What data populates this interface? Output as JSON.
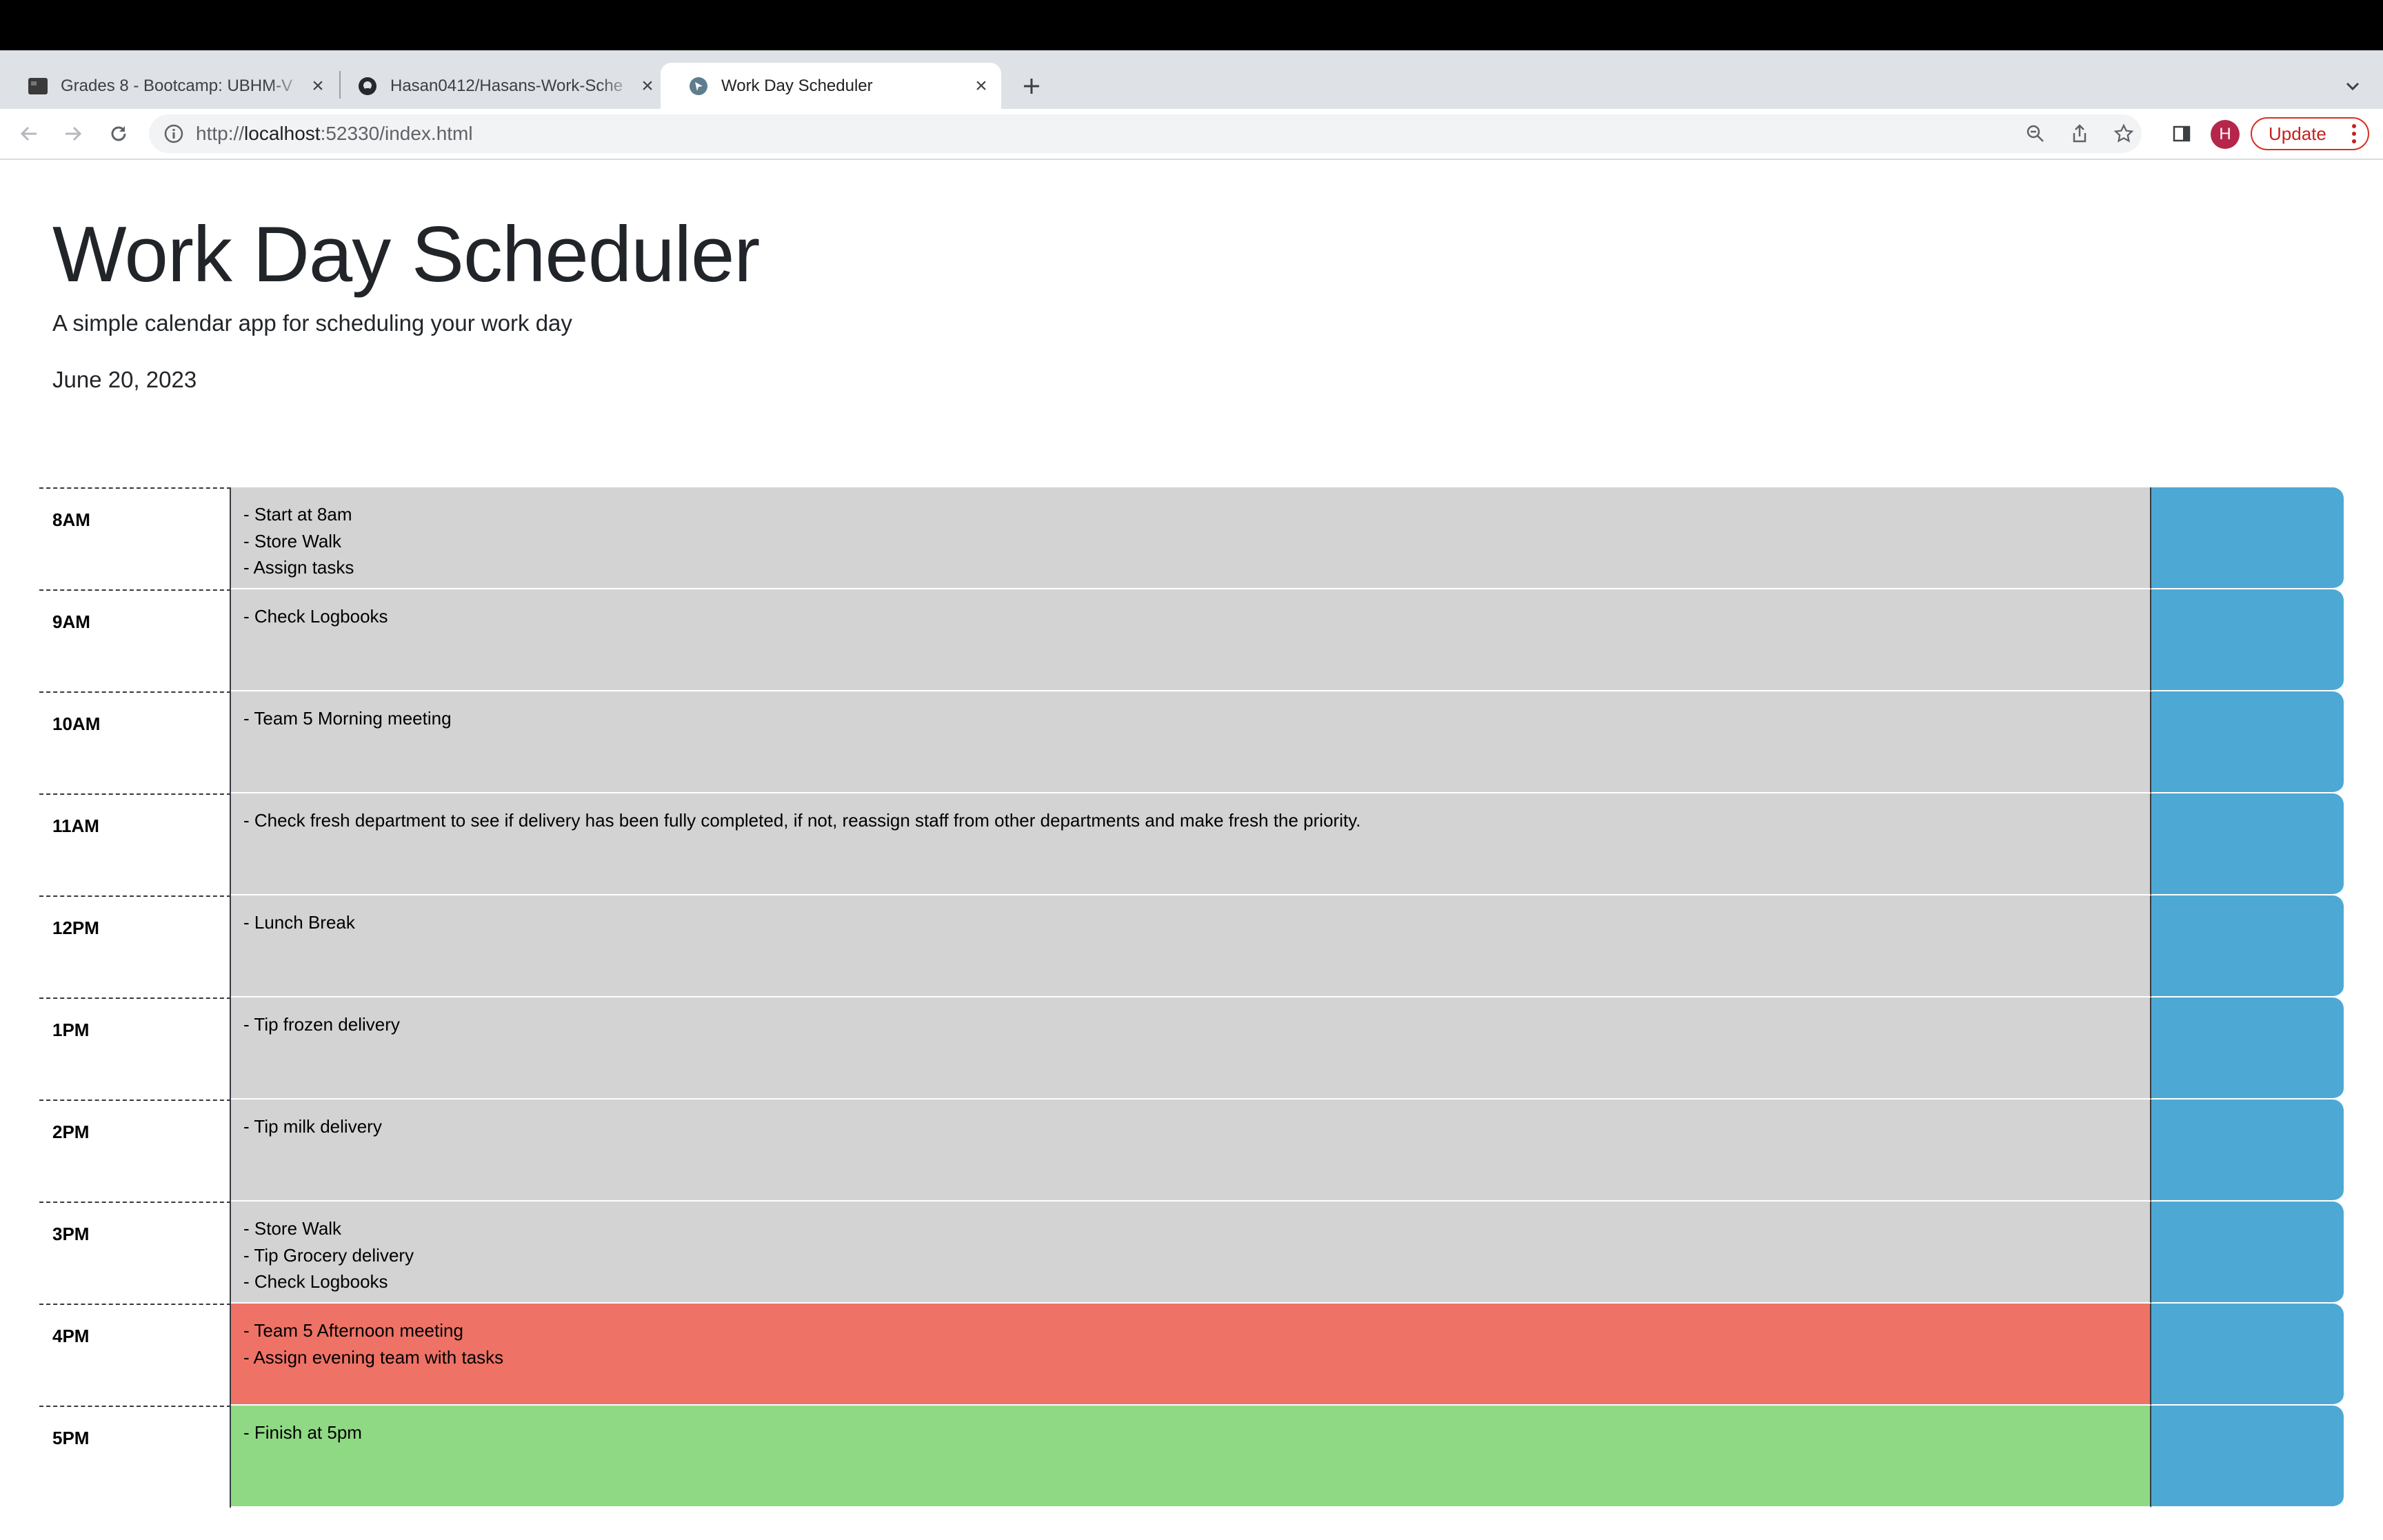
{
  "browser": {
    "tabs": [
      {
        "title": "Grades 8 - Bootcamp: UBHM-V",
        "favicon": "canvas-icon"
      },
      {
        "title": "Hasan0412/Hasans-Work-Sche",
        "favicon": "github-icon"
      },
      {
        "title": "Work Day Scheduler",
        "favicon": "site-icon"
      }
    ],
    "url_prefix": "http://",
    "url_host": "localhost",
    "url_rest": ":52330/index.html",
    "avatar_letter": "H",
    "update_label": "Update"
  },
  "page": {
    "title": "Work Day Scheduler",
    "lead": "A simple calendar app for scheduling your work day",
    "date": "June 20, 2023"
  },
  "schedule": [
    {
      "hour": "8AM",
      "text": "- Start at 8am\n- Store Walk\n- Assign tasks",
      "state": "past"
    },
    {
      "hour": "9AM",
      "text": "- Check Logbooks",
      "state": "past"
    },
    {
      "hour": "10AM",
      "text": "- Team 5 Morning meeting",
      "state": "past"
    },
    {
      "hour": "11AM",
      "text": "- Check fresh department to see if delivery has been fully completed, if not, reassign staff from other departments and make fresh the priority.",
      "state": "past"
    },
    {
      "hour": "12PM",
      "text": "- Lunch Break",
      "state": "past"
    },
    {
      "hour": "1PM",
      "text": "- Tip frozen delivery",
      "state": "past"
    },
    {
      "hour": "2PM",
      "text": "- Tip milk delivery",
      "state": "past"
    },
    {
      "hour": "3PM",
      "text": "- Store Walk\n- Tip Grocery delivery\n- Check Logbooks",
      "state": "past"
    },
    {
      "hour": "4PM",
      "text": "- Team 5 Afternoon meeting\n- Assign evening team with tasks",
      "state": "present"
    },
    {
      "hour": "5PM",
      "text": "- Finish at 5pm",
      "state": "future"
    }
  ],
  "colors": {
    "past": "#d3d3d3",
    "present": "#ee7266",
    "future": "#8fd984",
    "save_button": "#4da9d4",
    "update_accent": "#c5221f",
    "avatar": "#b5264a"
  }
}
